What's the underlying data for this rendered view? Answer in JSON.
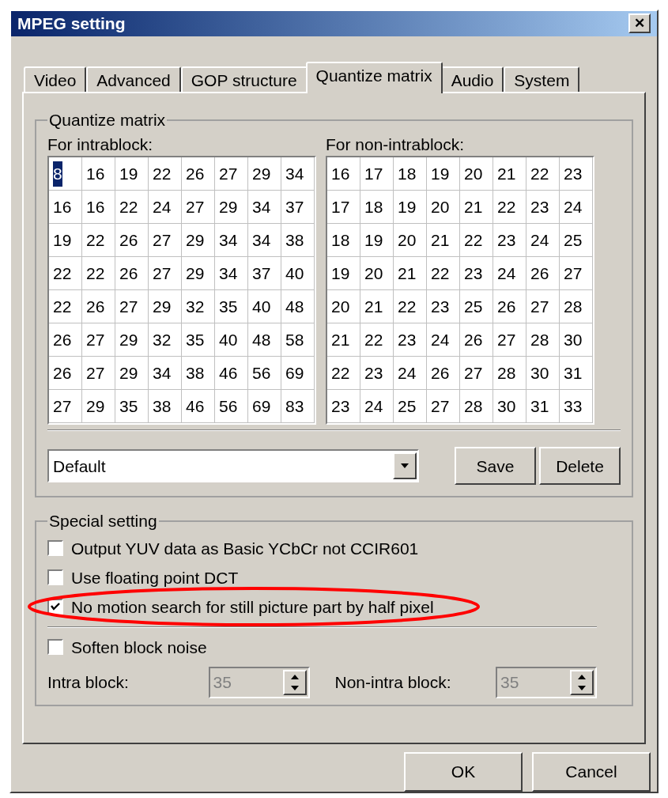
{
  "window": {
    "title": "MPEG setting",
    "close": "✕"
  },
  "tabs": [
    {
      "label": "Video",
      "selected": false
    },
    {
      "label": "Advanced",
      "selected": false
    },
    {
      "label": "GOP structure",
      "selected": false
    },
    {
      "label": "Quantize matrix",
      "selected": true
    },
    {
      "label": "Audio",
      "selected": false
    },
    {
      "label": "System",
      "selected": false
    }
  ],
  "quantize_group": {
    "title": "Quantize matrix",
    "matrices": [
      {
        "label": "For intrablock:",
        "rows": [
          [
            {
              "value": "8",
              "selected": true
            },
            {
              "value": "16",
              "selected": false
            },
            {
              "value": "19",
              "selected": false
            },
            {
              "value": "22",
              "selected": false
            },
            {
              "value": "26",
              "selected": false
            },
            {
              "value": "27",
              "selected": false
            },
            {
              "value": "29",
              "selected": false
            },
            {
              "value": "34",
              "selected": false
            }
          ],
          [
            {
              "value": "16",
              "selected": false
            },
            {
              "value": "16",
              "selected": false
            },
            {
              "value": "22",
              "selected": false
            },
            {
              "value": "24",
              "selected": false
            },
            {
              "value": "27",
              "selected": false
            },
            {
              "value": "29",
              "selected": false
            },
            {
              "value": "34",
              "selected": false
            },
            {
              "value": "37",
              "selected": false
            }
          ],
          [
            {
              "value": "19",
              "selected": false
            },
            {
              "value": "22",
              "selected": false
            },
            {
              "value": "26",
              "selected": false
            },
            {
              "value": "27",
              "selected": false
            },
            {
              "value": "29",
              "selected": false
            },
            {
              "value": "34",
              "selected": false
            },
            {
              "value": "34",
              "selected": false
            },
            {
              "value": "38",
              "selected": false
            }
          ],
          [
            {
              "value": "22",
              "selected": false
            },
            {
              "value": "22",
              "selected": false
            },
            {
              "value": "26",
              "selected": false
            },
            {
              "value": "27",
              "selected": false
            },
            {
              "value": "29",
              "selected": false
            },
            {
              "value": "34",
              "selected": false
            },
            {
              "value": "37",
              "selected": false
            },
            {
              "value": "40",
              "selected": false
            }
          ],
          [
            {
              "value": "22",
              "selected": false
            },
            {
              "value": "26",
              "selected": false
            },
            {
              "value": "27",
              "selected": false
            },
            {
              "value": "29",
              "selected": false
            },
            {
              "value": "32",
              "selected": false
            },
            {
              "value": "35",
              "selected": false
            },
            {
              "value": "40",
              "selected": false
            },
            {
              "value": "48",
              "selected": false
            }
          ],
          [
            {
              "value": "26",
              "selected": false
            },
            {
              "value": "27",
              "selected": false
            },
            {
              "value": "29",
              "selected": false
            },
            {
              "value": "32",
              "selected": false
            },
            {
              "value": "35",
              "selected": false
            },
            {
              "value": "40",
              "selected": false
            },
            {
              "value": "48",
              "selected": false
            },
            {
              "value": "58",
              "selected": false
            }
          ],
          [
            {
              "value": "26",
              "selected": false
            },
            {
              "value": "27",
              "selected": false
            },
            {
              "value": "29",
              "selected": false
            },
            {
              "value": "34",
              "selected": false
            },
            {
              "value": "38",
              "selected": false
            },
            {
              "value": "46",
              "selected": false
            },
            {
              "value": "56",
              "selected": false
            },
            {
              "value": "69",
              "selected": false
            }
          ],
          [
            {
              "value": "27",
              "selected": false
            },
            {
              "value": "29",
              "selected": false
            },
            {
              "value": "35",
              "selected": false
            },
            {
              "value": "38",
              "selected": false
            },
            {
              "value": "46",
              "selected": false
            },
            {
              "value": "56",
              "selected": false
            },
            {
              "value": "69",
              "selected": false
            },
            {
              "value": "83",
              "selected": false
            }
          ]
        ]
      },
      {
        "label": "For non-intrablock:",
        "rows": [
          [
            {
              "value": "16",
              "selected": false
            },
            {
              "value": "17",
              "selected": false
            },
            {
              "value": "18",
              "selected": false
            },
            {
              "value": "19",
              "selected": false
            },
            {
              "value": "20",
              "selected": false
            },
            {
              "value": "21",
              "selected": false
            },
            {
              "value": "22",
              "selected": false
            },
            {
              "value": "23",
              "selected": false
            }
          ],
          [
            {
              "value": "17",
              "selected": false
            },
            {
              "value": "18",
              "selected": false
            },
            {
              "value": "19",
              "selected": false
            },
            {
              "value": "20",
              "selected": false
            },
            {
              "value": "21",
              "selected": false
            },
            {
              "value": "22",
              "selected": false
            },
            {
              "value": "23",
              "selected": false
            },
            {
              "value": "24",
              "selected": false
            }
          ],
          [
            {
              "value": "18",
              "selected": false
            },
            {
              "value": "19",
              "selected": false
            },
            {
              "value": "20",
              "selected": false
            },
            {
              "value": "21",
              "selected": false
            },
            {
              "value": "22",
              "selected": false
            },
            {
              "value": "23",
              "selected": false
            },
            {
              "value": "24",
              "selected": false
            },
            {
              "value": "25",
              "selected": false
            }
          ],
          [
            {
              "value": "19",
              "selected": false
            },
            {
              "value": "20",
              "selected": false
            },
            {
              "value": "21",
              "selected": false
            },
            {
              "value": "22",
              "selected": false
            },
            {
              "value": "23",
              "selected": false
            },
            {
              "value": "24",
              "selected": false
            },
            {
              "value": "26",
              "selected": false
            },
            {
              "value": "27",
              "selected": false
            }
          ],
          [
            {
              "value": "20",
              "selected": false
            },
            {
              "value": "21",
              "selected": false
            },
            {
              "value": "22",
              "selected": false
            },
            {
              "value": "23",
              "selected": false
            },
            {
              "value": "25",
              "selected": false
            },
            {
              "value": "26",
              "selected": false
            },
            {
              "value": "27",
              "selected": false
            },
            {
              "value": "28",
              "selected": false
            }
          ],
          [
            {
              "value": "21",
              "selected": false
            },
            {
              "value": "22",
              "selected": false
            },
            {
              "value": "23",
              "selected": false
            },
            {
              "value": "24",
              "selected": false
            },
            {
              "value": "26",
              "selected": false
            },
            {
              "value": "27",
              "selected": false
            },
            {
              "value": "28",
              "selected": false
            },
            {
              "value": "30",
              "selected": false
            }
          ],
          [
            {
              "value": "22",
              "selected": false
            },
            {
              "value": "23",
              "selected": false
            },
            {
              "value": "24",
              "selected": false
            },
            {
              "value": "26",
              "selected": false
            },
            {
              "value": "27",
              "selected": false
            },
            {
              "value": "28",
              "selected": false
            },
            {
              "value": "30",
              "selected": false
            },
            {
              "value": "31",
              "selected": false
            }
          ],
          [
            {
              "value": "23",
              "selected": false
            },
            {
              "value": "24",
              "selected": false
            },
            {
              "value": "25",
              "selected": false
            },
            {
              "value": "27",
              "selected": false
            },
            {
              "value": "28",
              "selected": false
            },
            {
              "value": "30",
              "selected": false
            },
            {
              "value": "31",
              "selected": false
            },
            {
              "value": "33",
              "selected": false
            }
          ]
        ]
      }
    ],
    "preset": {
      "value": "Default"
    },
    "buttons": [
      "Save",
      "Delete"
    ]
  },
  "special_group": {
    "title": "Special setting",
    "options": [
      {
        "label": "Output YUV data as Basic YCbCr not CCIR601",
        "checked": false,
        "circled": false
      },
      {
        "label": "Use floating point DCT",
        "checked": false,
        "circled": false
      },
      {
        "label": "No motion search for still picture part by half pixel",
        "checked": true,
        "circled": true
      }
    ],
    "soften": {
      "label": "Soften block noise",
      "checked": false
    },
    "spinners": [
      {
        "label": "Intra block:",
        "value": "35",
        "disabled": true
      },
      {
        "label": "Non-intra block:",
        "value": "35",
        "disabled": true
      }
    ]
  },
  "dialog_buttons": [
    "OK",
    "Cancel"
  ]
}
